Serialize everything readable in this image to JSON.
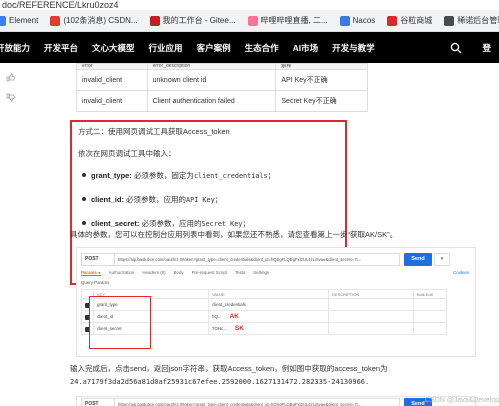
{
  "browser": {
    "url_partial": "doc/REFERENCE/Lkru0zoz4",
    "bookmarks": [
      {
        "label": "Element",
        "color": "#3d7df5"
      },
      {
        "label": "(102条消息) CSDN...",
        "color": "#e33b2e"
      },
      {
        "label": "我的工作台 - Gitee...",
        "color": "#c71d23"
      },
      {
        "label": "哔哩哔哩直播, 二...",
        "color": "#fb7299"
      },
      {
        "label": "Nacos",
        "color": "#3a7be0"
      },
      {
        "label": "谷粒商城",
        "color": "#e0272e"
      },
      {
        "label": "稀诺后台管理系统",
        "color": "#4a4a4a"
      },
      {
        "label": "谷主鲸",
        "color": "#6b8e23"
      }
    ]
  },
  "site_nav": {
    "items": [
      "开放能力",
      "开发平台",
      "文心大模型",
      "行业应用",
      "客户案例",
      "生态合作",
      "AI市场",
      "开发与教学"
    ],
    "login": "登"
  },
  "error_table": {
    "header": [
      "error",
      "error_description",
      "解释"
    ],
    "rows": [
      [
        "invalid_client",
        "unknown client id",
        "API Key不正确"
      ],
      [
        "invalid_client",
        "Client authentication failed",
        "Secret Key不正确"
      ]
    ]
  },
  "method2": {
    "title": "方式二：使用网页调试工具获取Access_token",
    "intro": "依次在网页调试工具中输入：",
    "params": [
      {
        "name": "grant_type",
        "desc": "必须参数，固定为",
        "code": "client_credentials",
        "end": "；"
      },
      {
        "name": "client_id",
        "desc": "必须参数，应用的",
        "code": "API Key",
        "end": "；"
      },
      {
        "name": "client_secret",
        "desc": "必须参数，应用的",
        "code": "Secret Key",
        "end": "；"
      }
    ],
    "note": "具体的参数，您可以在控制台应用列表中看到，如果您还不熟悉，请您查看第上一步“获取AK/SK”。"
  },
  "postman": {
    "method": "POST",
    "url": "https://aip.baidubce.com/oauth/2.0/token?grant_type=client_credentials&client_id=hQSgFLQBgFxl2UL4zLiSvae&client_secret=7t...",
    "send": "Send",
    "tabs": [
      "Params ●",
      "Authorization",
      "Headers (8)",
      "Body",
      "Pre-request Script",
      "Tests",
      "Settings"
    ],
    "cookies": "Cookies",
    "query_params_label": "Query Params",
    "columns": [
      "KEY",
      "VALUE",
      "DESCRIPTION",
      "Bulk Edit"
    ],
    "rows": [
      {
        "key": "grant_type",
        "value": "client_credentials",
        "mark": ""
      },
      {
        "key": "client_id",
        "value": "hQ...",
        "mark": "AK"
      },
      {
        "key": "client_secret",
        "value": "7OHc...",
        "mark": "SK"
      }
    ]
  },
  "result": {
    "line1": "输入完成后，点击send，返回json字符串，获取Access_token，例如图中获取的access_token为",
    "line2": "24.a7179f3da2d56a81d0af25931c67efee.2592000.1627131472.282335-24130966."
  },
  "postman2": {
    "method": "POST",
    "url": "https://aip.baidubce.com/oauth/2.0/token?grant_type=client_credentials&client_id=hQSgFLQBgFxl2UL4zLiSvae&client_secret=7t...",
    "send": "Send"
  },
  "watermark": "CSDN @Java&Develop"
}
